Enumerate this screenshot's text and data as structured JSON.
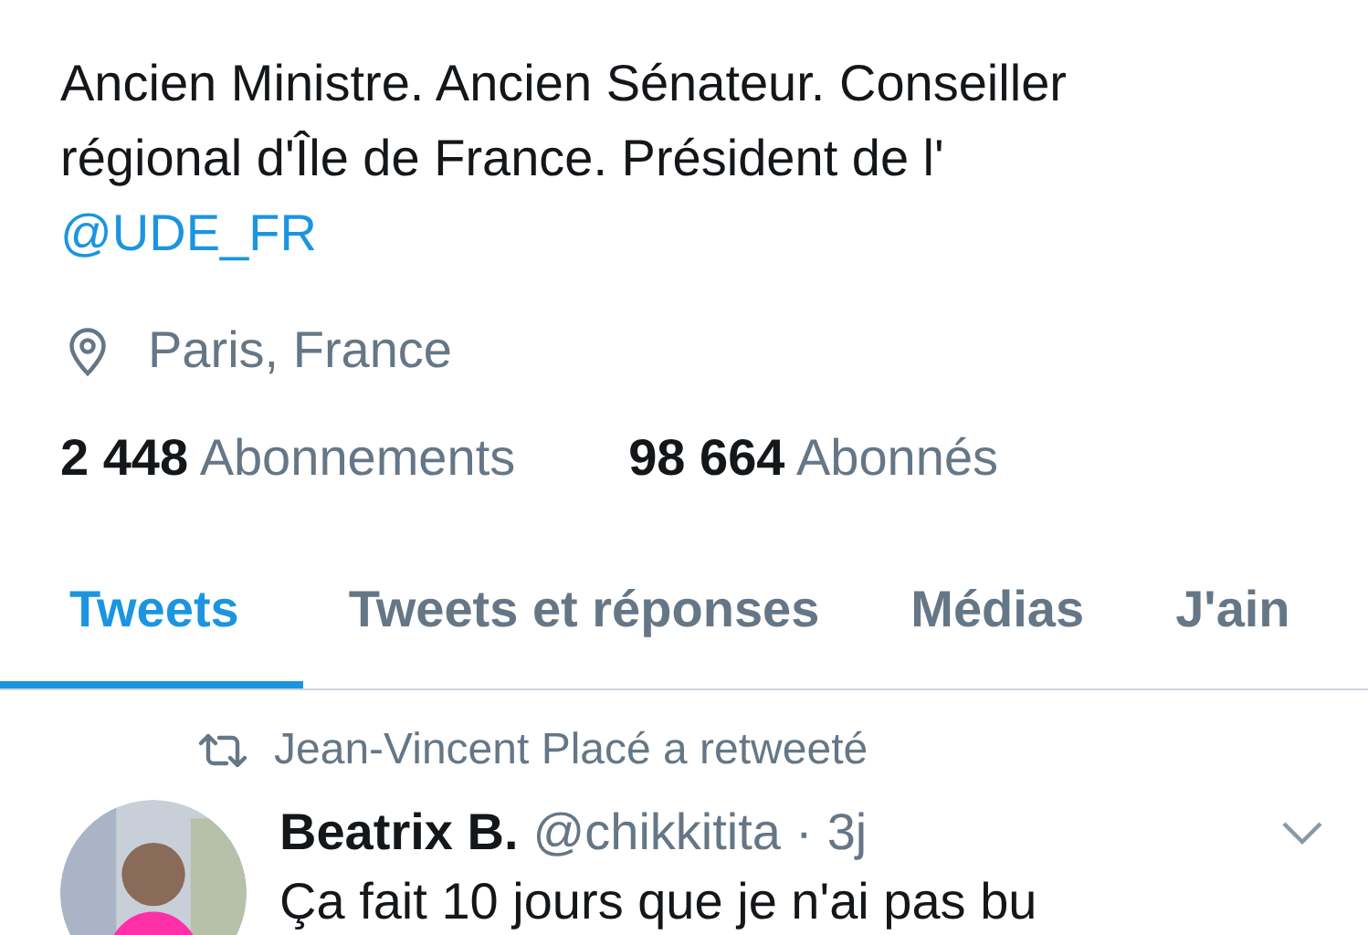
{
  "profile": {
    "bio": "Ancien Ministre. Ancien Sénateur. Conseiller régional d'Île de France. Président de l'",
    "bio_link": "@UDE_FR",
    "location": "Paris, France",
    "stats": [
      {
        "count": "2 448",
        "label": "Abonnements"
      },
      {
        "count": "98 664",
        "label": "Abonnés"
      }
    ]
  },
  "tabs": [
    {
      "label": "Tweets",
      "selected": true
    },
    {
      "label": "Tweets et réponses",
      "selected": false
    },
    {
      "label": "Médias",
      "selected": false
    },
    {
      "label": "J'ain",
      "selected": false
    }
  ],
  "tweet": {
    "retweeted_by": "Jean-Vincent Placé a retweeté",
    "author": "Beatrix B.",
    "username": "@chikkitita",
    "separator": "·",
    "time": "3j",
    "text": "Ça fait 10 jours que je n'ai pas bu"
  }
}
